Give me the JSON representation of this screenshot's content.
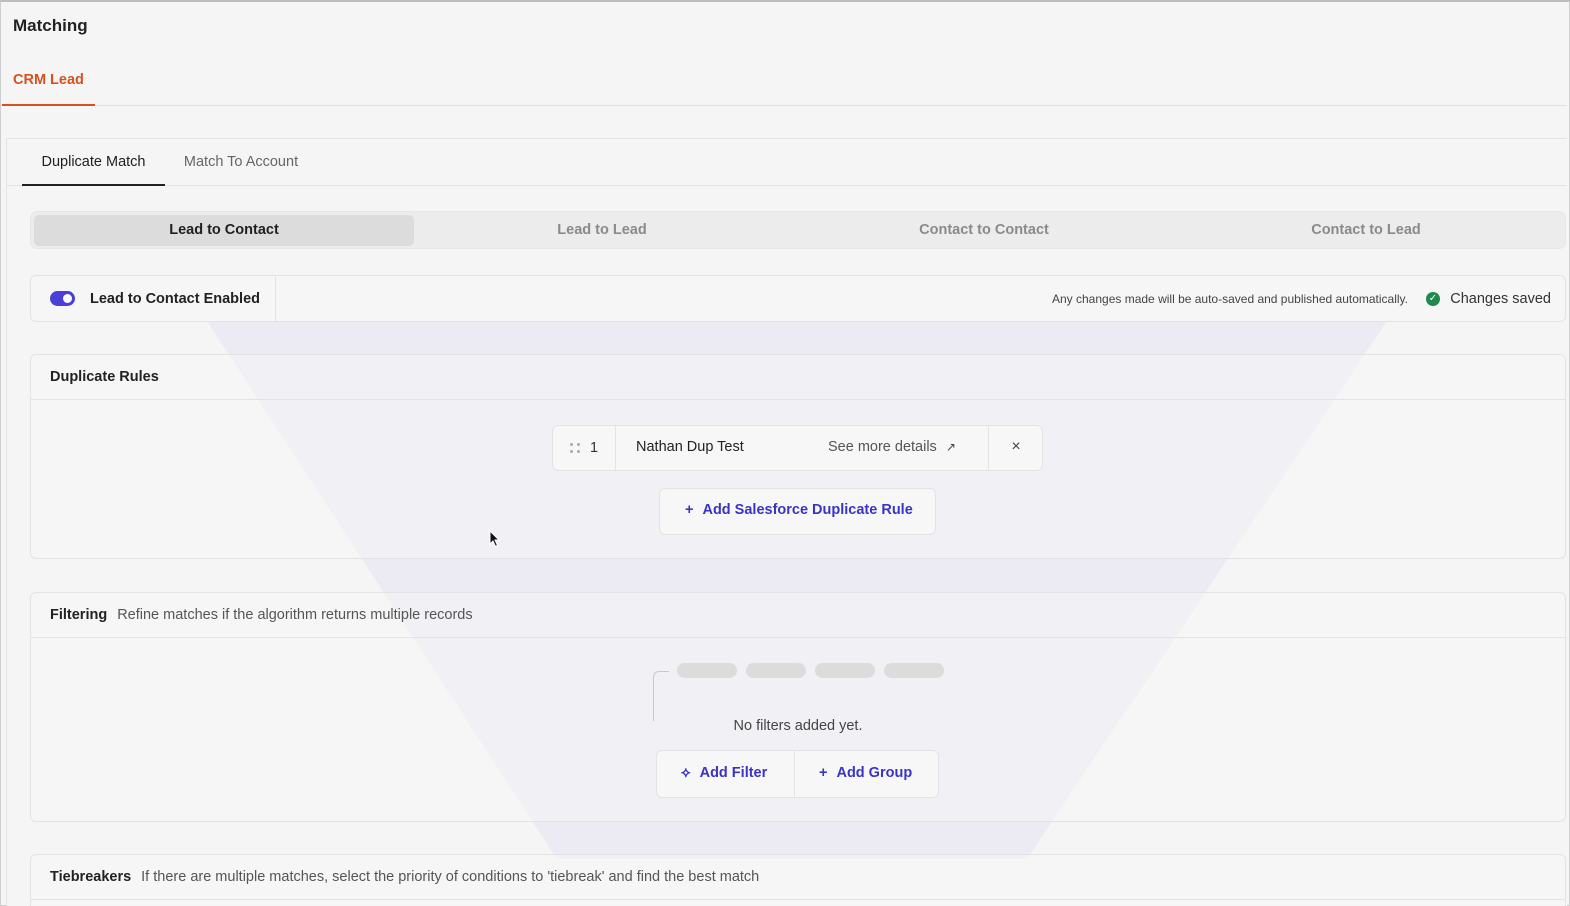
{
  "page": {
    "title": "Matching"
  },
  "object_tabs": [
    {
      "label": "CRM Lead",
      "active": true
    }
  ],
  "match_tabs": [
    {
      "label": "Duplicate Match",
      "active": true
    },
    {
      "label": "Match To Account",
      "active": false
    }
  ],
  "segments": [
    {
      "label": "Lead to Contact",
      "active": true
    },
    {
      "label": "Lead to Lead",
      "active": false
    },
    {
      "label": "Contact to Contact",
      "active": false
    },
    {
      "label": "Contact to Lead",
      "active": false
    }
  ],
  "enable_bar": {
    "label": "Lead to Contact Enabled",
    "enabled": true,
    "autosave_note": "Any changes made will be auto-saved and published automatically.",
    "saved_label": "Changes saved"
  },
  "duplicate_rules": {
    "title": "Duplicate Rules",
    "rules": [
      {
        "index": "1",
        "name": "Nathan Dup Test",
        "details_label": "See more details"
      }
    ],
    "add_label": "Add Salesforce Duplicate Rule"
  },
  "filtering": {
    "title": "Filtering",
    "subtitle": "Refine matches if the algorithm returns multiple records",
    "empty_text": "No filters added yet.",
    "add_filter_label": "Add Filter",
    "add_group_label": "Add Group"
  },
  "tiebreakers": {
    "title": "Tiebreakers",
    "subtitle": "If there are multiple matches, select the priority of conditions to 'tiebreak' and find the best match"
  },
  "colors": {
    "accent": "#4b3fd6",
    "link": "#3a34c4",
    "object_tab": "#d5521f",
    "saved": "#1f8a4c"
  }
}
